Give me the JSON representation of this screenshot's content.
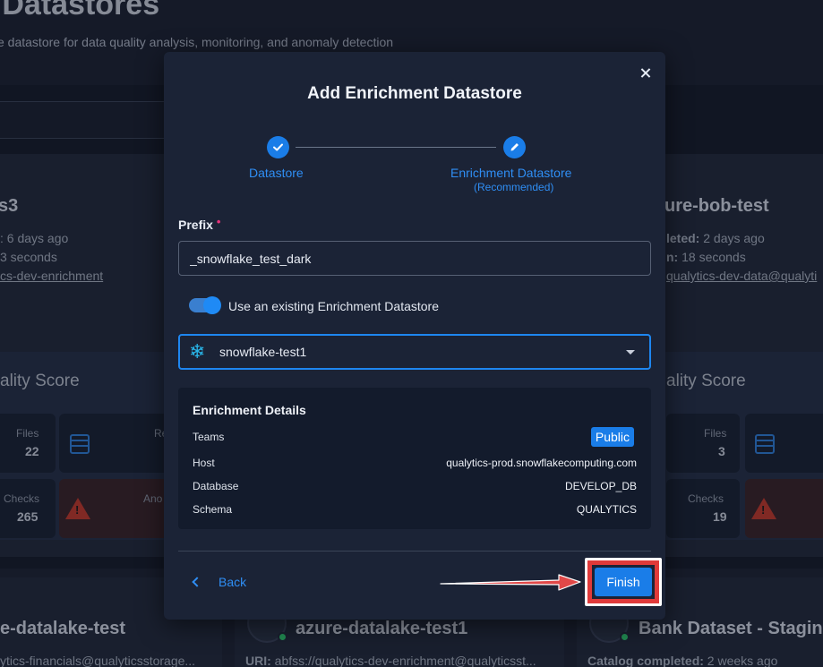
{
  "background": {
    "page_title": "e Datastores",
    "page_subtitle": "ce datastore for data quality analysis, monitoring, and anomaly detection",
    "left_card": {
      "name": "s3",
      "line1": ": 6 days ago",
      "line2": "3 seconds",
      "line3": "cs-dev-enrichment",
      "quality_score": "ality Score",
      "files_label": "Files",
      "files_value": "22",
      "r_label": "Re",
      "checks_label": "Checks",
      "checks_value": "265",
      "anomalies_label": "Ano"
    },
    "right_card": {
      "name": "ure-bob-test",
      "line1_key": "leted:",
      "line1_val": " 2 days ago",
      "line2_key": "n:",
      "line2_val": " 18 seconds",
      "line3": "qualytics-dev-data@qualyti",
      "quality_score": "ality Score",
      "files_label": "Files",
      "files_value": "3",
      "checks_label": "Checks",
      "checks_value": "19"
    },
    "bottom_cards": [
      {
        "name": "e-datalake-test",
        "line": "ytics-financials@qualyticsstorage..."
      },
      {
        "name": "azure-datalake-test1",
        "line_key": "URI:",
        "line_val": " abfss://qualytics-dev-enrichment@qualyticsst..."
      },
      {
        "name": "Bank Dataset - Stagin",
        "line_key": "Catalog completed:",
        "line_val": " 2 weeks ago"
      }
    ]
  },
  "modal": {
    "title": "Add Enrichment Datastore",
    "steps": [
      {
        "label": "Datastore",
        "sub": ""
      },
      {
        "label": "Enrichment Datastore",
        "sub": "(Recommended)"
      }
    ],
    "prefix_label": "Prefix",
    "required_mark": "•",
    "prefix_value": "_snowflake_test_dark",
    "toggle_label": "Use an existing Enrichment Datastore",
    "toggle_on": true,
    "selected_datastore": "snowflake-test1",
    "details": {
      "title": "Enrichment Details",
      "rows": [
        {
          "key": "Teams",
          "value": "Public"
        },
        {
          "key": "Host",
          "value": "qualytics-prod.snowflakecomputing.com"
        },
        {
          "key": "Database",
          "value": "DEVELOP_DB"
        },
        {
          "key": "Schema",
          "value": "QUALYTICS"
        }
      ]
    },
    "back_label": "Back",
    "finish_label": "Finish"
  },
  "colors": {
    "accent": "#1a7de8",
    "highlight_frame": "#e03a3a",
    "required": "#e5327a"
  }
}
